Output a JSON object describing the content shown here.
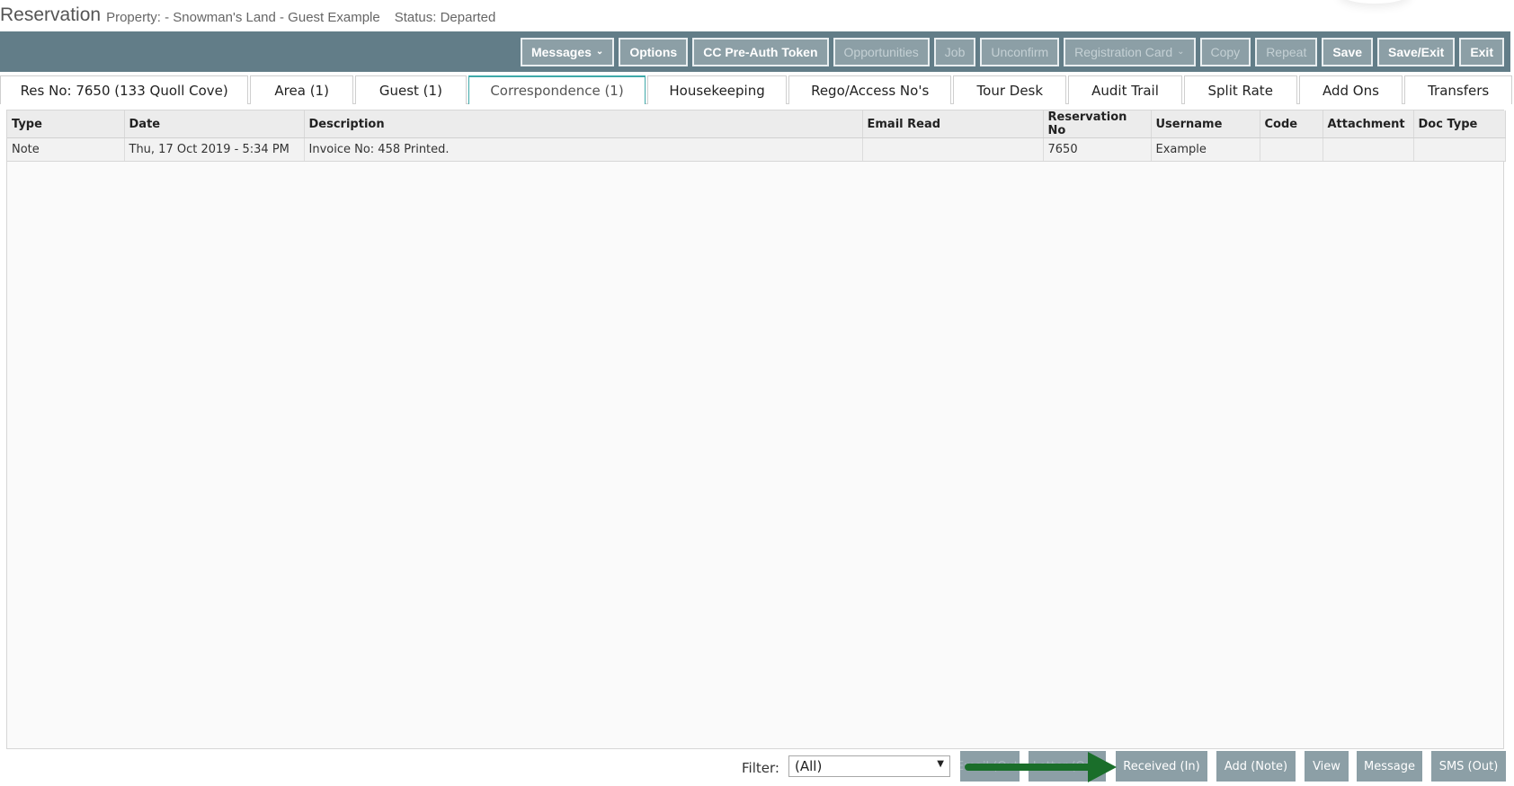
{
  "header": {
    "title": "Reservation",
    "subtitle": "Property: - Snowman's Land -  Guest Example",
    "status": "Status: Departed"
  },
  "toolbar": {
    "buttons": [
      {
        "label": "Messages",
        "dropdown": true,
        "enabled": true
      },
      {
        "label": "Options",
        "enabled": true
      },
      {
        "label": "CC Pre-Auth Token",
        "enabled": true
      },
      {
        "label": "Opportunities",
        "enabled": false
      },
      {
        "label": "Job",
        "enabled": false
      },
      {
        "label": "Unconfirm",
        "enabled": false
      },
      {
        "label": "Registration Card",
        "dropdown": true,
        "enabled": true
      },
      {
        "label": "Copy",
        "enabled": false
      },
      {
        "label": "Repeat",
        "enabled": false
      },
      {
        "label": "Save",
        "enabled": true
      },
      {
        "label": "Save/Exit",
        "enabled": true
      },
      {
        "label": "Exit",
        "enabled": true
      }
    ]
  },
  "tabs": [
    {
      "label": "Res No: 7650 (133 Quoll Cove)",
      "active": false
    },
    {
      "label": "Area (1)",
      "active": false
    },
    {
      "label": "Guest (1)",
      "active": false
    },
    {
      "label": "Correspondence (1)",
      "active": true
    },
    {
      "label": "Housekeeping",
      "active": false
    },
    {
      "label": "Rego/Access No's",
      "active": false
    },
    {
      "label": "Tour Desk",
      "active": false
    },
    {
      "label": "Audit Trail",
      "active": false
    },
    {
      "label": "Split Rate",
      "active": false
    },
    {
      "label": "Add Ons",
      "active": false
    },
    {
      "label": "Transfers",
      "active": false
    }
  ],
  "grid": {
    "columns": [
      "Type",
      "Date",
      "Description",
      "Email Read",
      "Reservation No",
      "Username",
      "Code",
      "Attachment",
      "Doc Type"
    ],
    "rows": [
      [
        "Note",
        "Thu, 17 Oct 2019 - 5:34 PM",
        "Invoice No: 458 Printed.",
        "",
        "7650",
        "Example",
        "",
        "",
        ""
      ]
    ]
  },
  "footer": {
    "filter_label": "Filter:",
    "filter_value": "(All)",
    "buttons": [
      "Email (Out)",
      "Letter (Out)",
      "Received (In)",
      "Add (Note)",
      "View",
      "Message",
      "SMS (Out)"
    ]
  },
  "colors": {
    "toolbar_bg": "#627d88",
    "button_bg": "#8c9fa6",
    "active_tab_accent": "#3fa9a9",
    "annotation_arrow": "#1a6e2a"
  }
}
